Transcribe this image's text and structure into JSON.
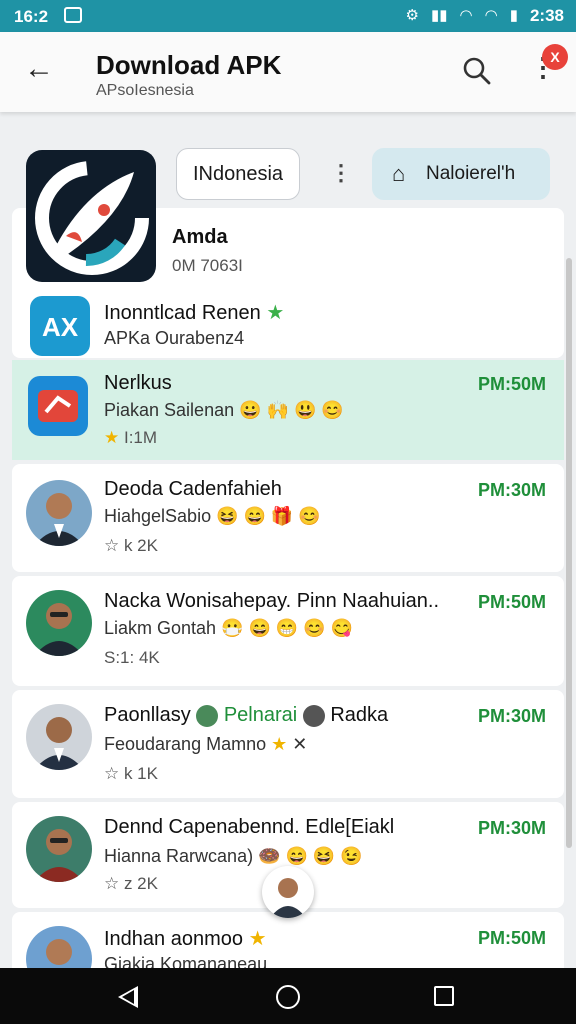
{
  "status_bar": {
    "time_left": "16:2",
    "time_right": "2:38"
  },
  "app_bar": {
    "title": "Download APK",
    "subtitle": "APsoIesnesia",
    "notification_count": "X"
  },
  "header": {
    "chip_label": "INdonesia",
    "action_label": "Naloierel'h"
  },
  "pinned": {
    "name": "Amda",
    "meta": "0M 7063I"
  },
  "rows": [
    {
      "name": "Inonntlcad Renen",
      "msg": "APKa Ourabenz4",
      "meta": "",
      "time": "",
      "kind": "app-blue"
    },
    {
      "name": "Nerlkus",
      "msg": "Piakan Sailenan",
      "meta": "I:1M",
      "time": "PM:50M",
      "kind": "app-red"
    },
    {
      "name": "Deoda Cadenfahieh",
      "msg": "HiahgelSabio",
      "meta": "☆ k 2K",
      "time": "PM:30M",
      "kind": "person"
    },
    {
      "name": "Nacka Wonisahepay. Pinn Naahuian..",
      "msg": "Liakm Gontah",
      "meta": "S:1: 4K",
      "time": "PM:50M",
      "kind": "person"
    },
    {
      "name": "Paonllasy",
      "name2": "Pelnarai",
      "name3": "Radka",
      "msg": "Feoudarang Mamno",
      "meta": "☆ k 1K",
      "time": "PM:30M",
      "kind": "person"
    },
    {
      "name": "Dennd Capenabennd. Edle[Eiakl",
      "msg": "Hianna Rarwcana)",
      "meta": "☆ z 2K",
      "time": "PM:30M",
      "kind": "person"
    },
    {
      "name": "Indhan aonmoo",
      "msg": "Giakia Komananeau",
      "meta": "",
      "time": "PM:50M",
      "kind": "person"
    }
  ],
  "colors": {
    "accent": "#1f93a5",
    "time_green": "#1f8f3a",
    "highlight": "#d6f1e6"
  }
}
